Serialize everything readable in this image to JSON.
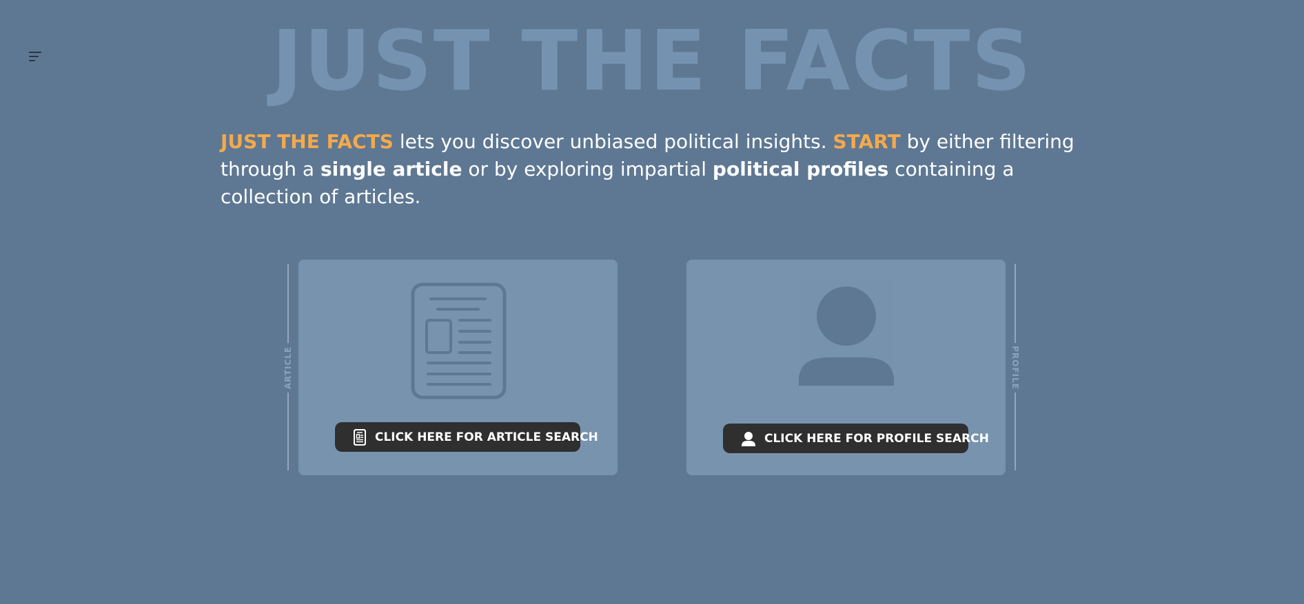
{
  "header": {
    "menu_icon": "menu-lines-icon",
    "title": "JUST THE FACTS"
  },
  "intro": {
    "brand": "JUST THE FACTS",
    "text1": " lets you discover unbiased political insights. ",
    "start": "START",
    "text2": " by either filtering through a ",
    "single_article": "single article",
    "text3": " or by exploring impartial ",
    "political_profiles": "political profiles",
    "text4": " containing a collection of articles."
  },
  "cards": {
    "article": {
      "side_label": "ARTICLE",
      "illustration_icon": "document-icon",
      "button_icon": "document-icon",
      "button_label": "CLICK HERE FOR ARTICLE SEARCH"
    },
    "profile": {
      "side_label": "PROFILE",
      "illustration_icon": "user-icon",
      "button_icon": "user-icon",
      "button_label": "CLICK HERE FOR PROFILE SEARCH"
    }
  },
  "colors": {
    "background": "#5e7893",
    "title": "#7593b0",
    "accent": "#f5a94a",
    "card": "#7893ae",
    "button": "#2f2f30"
  }
}
